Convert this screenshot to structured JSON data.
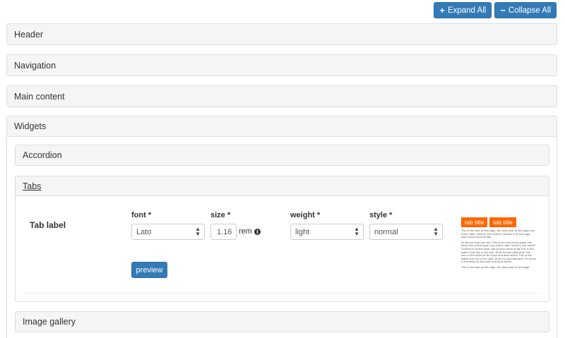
{
  "toolbar": {
    "expand_all": "Expand All",
    "collapse_all": "Collapse All"
  },
  "sections": {
    "header": "Header",
    "navigation": "Navigation",
    "main_content": "Main content",
    "widgets": "Widgets"
  },
  "widgets": {
    "accordion": "Accordion",
    "tabs": "Tabs",
    "image_gallery": "Image gallery"
  },
  "tabs_form": {
    "row_label": "Tab label",
    "font_label": "font *",
    "font_value": "Lato",
    "size_label": "size *",
    "size_value": "1.16",
    "size_unit": "rem",
    "weight_label": "weight *",
    "weight_value": "light",
    "style_label": "style *",
    "style_value": "normal",
    "preview_button": "preview"
  },
  "preview": {
    "tab1": "tab title",
    "tab2": "tab title",
    "para1": "This is the text of the page, the body text of the page you that's right, haven't you heard! Content is all the rage, wont have come of age.",
    "para2": "So let me here you say: This is the text of the page, the body text of the page, you that's right, haven't you heard! Content is all the rage, wond have come of ag This is the water. And this is the well. Drink full and descend. The hors is the white of the eyes and dark within.This is the water.And this is the well. Drink full and descend. Th horse is the white of the eyes and dark within.",
    "para3": "This is the text of the page, the body text of the page"
  },
  "colors": {
    "primary": "#337ab7",
    "tab_accent": "#ff6600",
    "panel_heading_bg": "#f5f5f5",
    "border": "#dddddd"
  },
  "icons": {
    "expand": "plus-icon",
    "collapse": "minus-icon",
    "size_info": "info-circle-icon",
    "select_caret": "updown-caret-icon"
  }
}
